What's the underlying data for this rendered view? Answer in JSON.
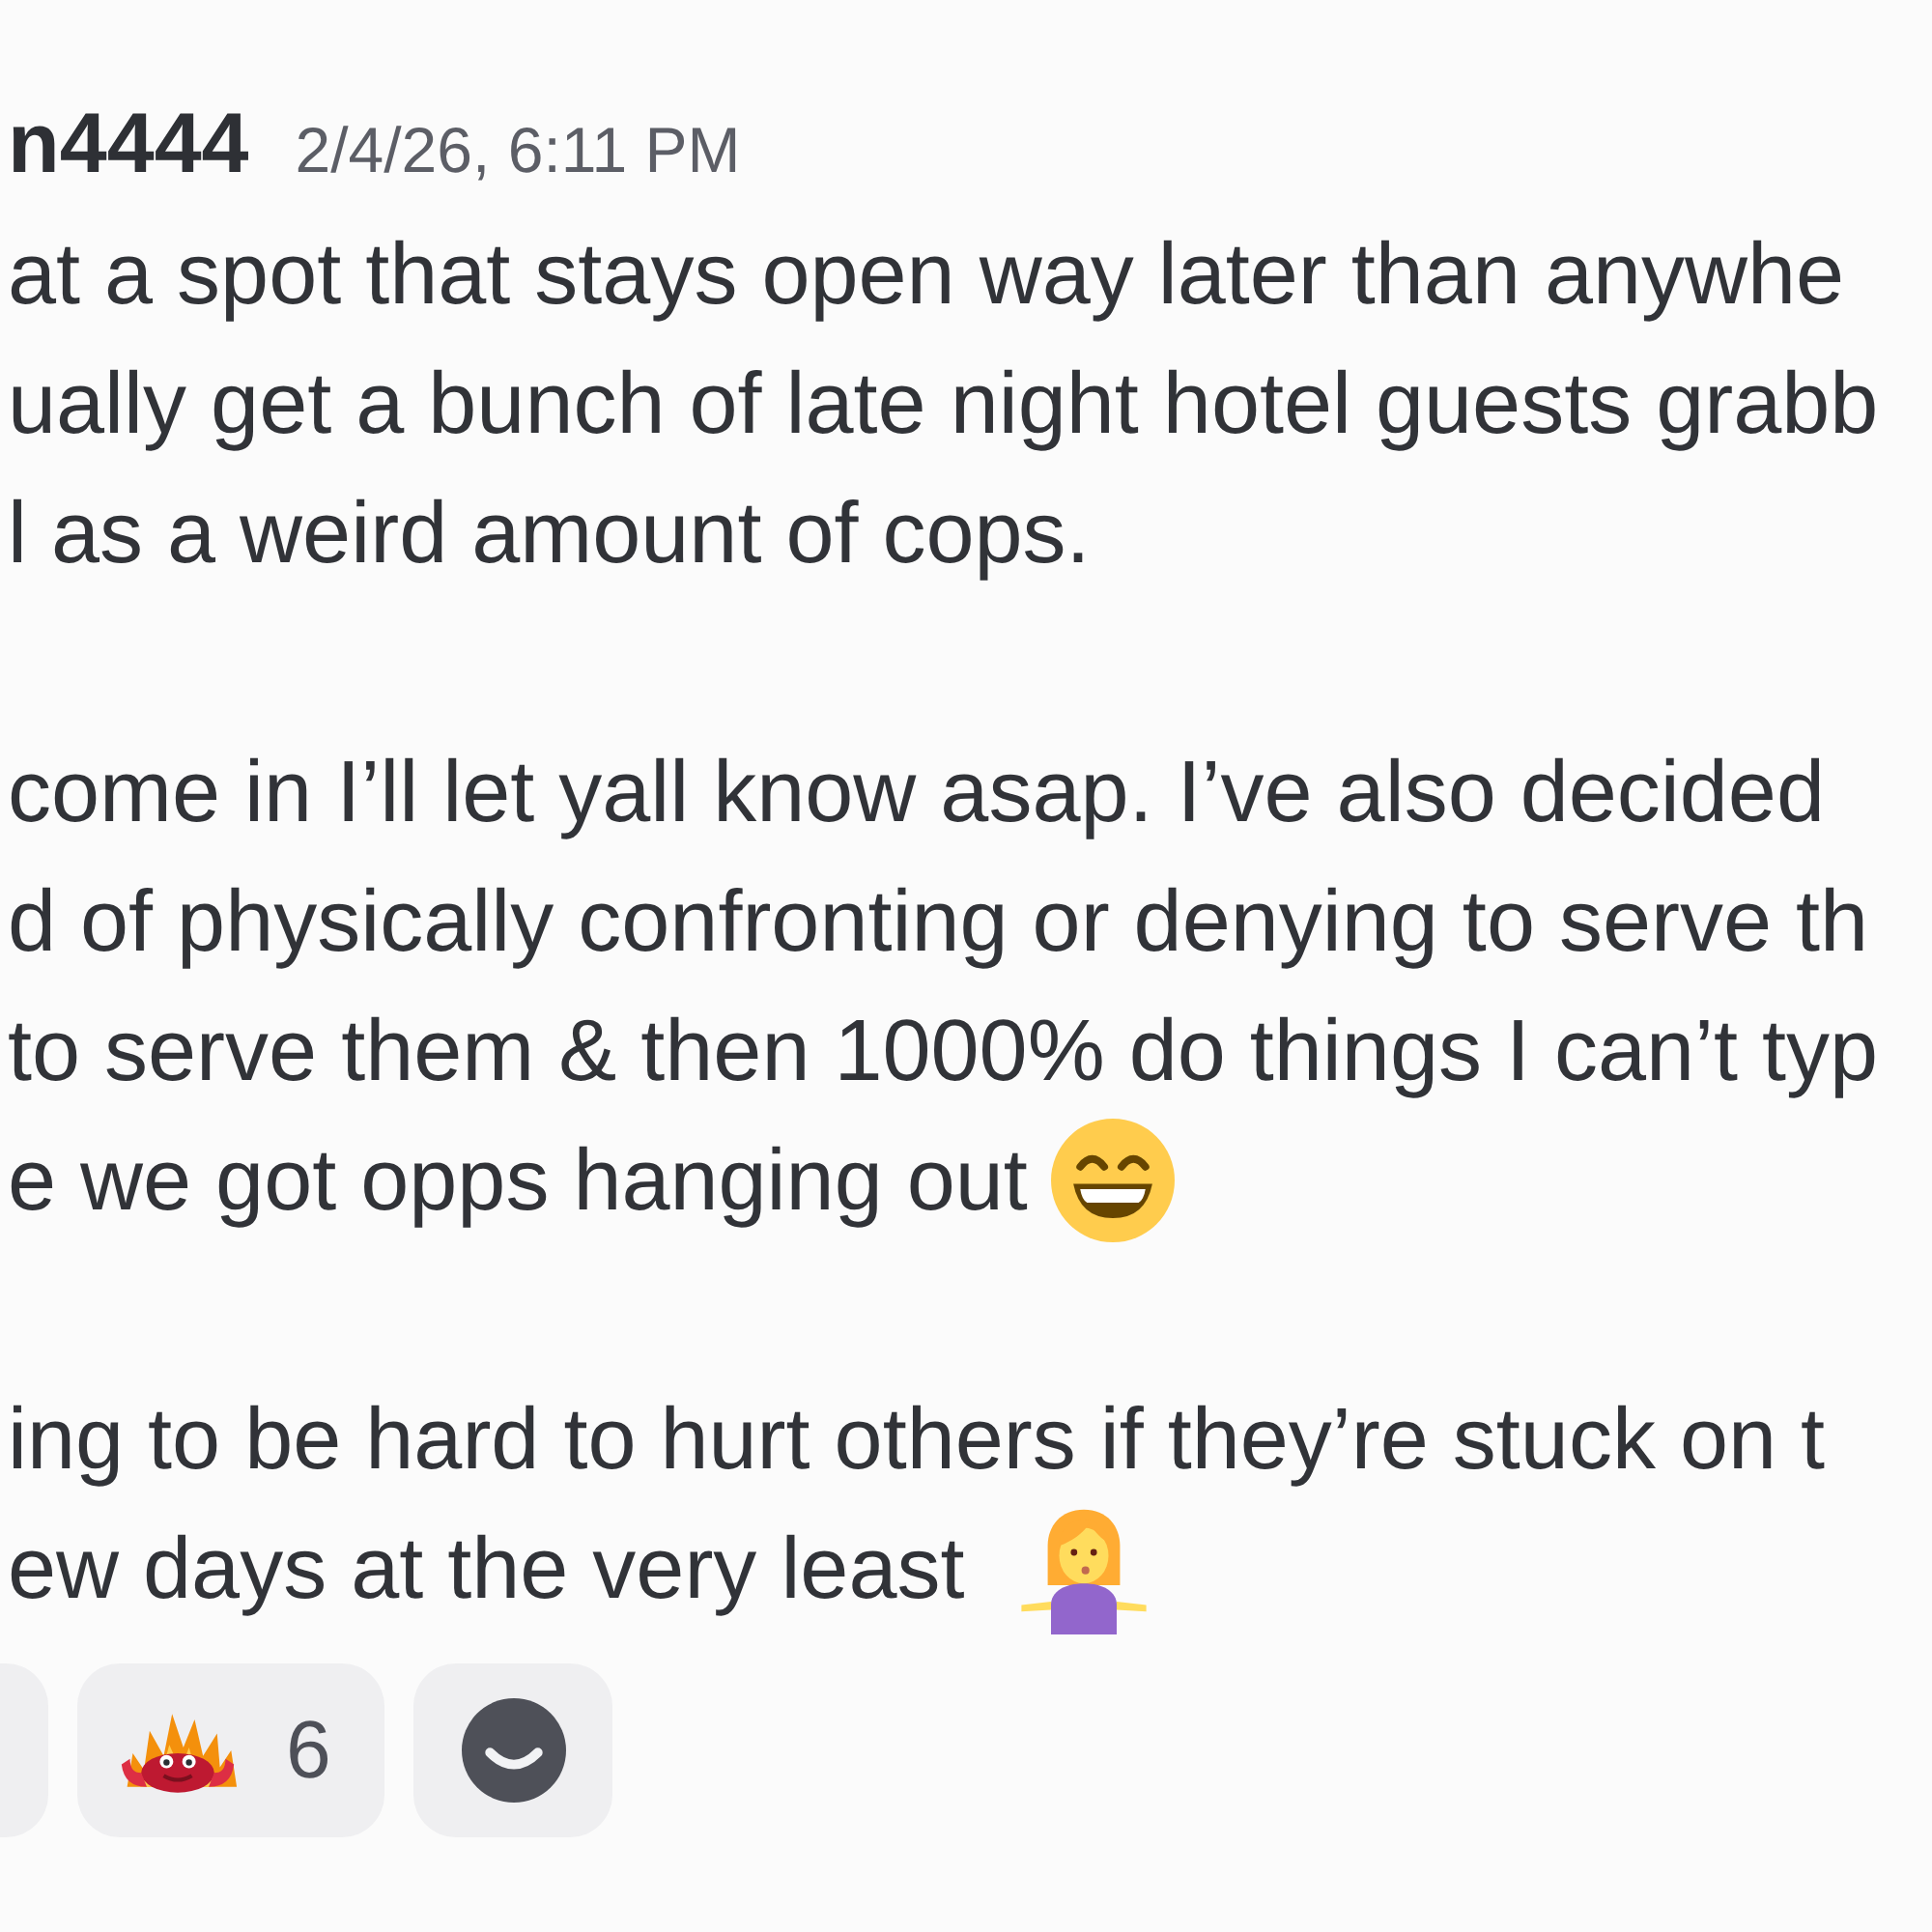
{
  "message": {
    "author": "n4444",
    "timestamp": "2/4/26, 6:11 PM",
    "paragraphs": [
      {
        "lines": [
          {
            "text": "at a spot that stays open way later than anywhe",
            "kind": "plain"
          },
          {
            "text": "ually get a bunch of late night hotel guests grabb",
            "kind": "plain"
          },
          {
            "text": "l as a weird amount of cops.",
            "kind": "plain"
          }
        ]
      },
      {
        "lines": [
          {
            "text": "come in I’ll let yall know asap. I’ve also decided",
            "kind": "plain"
          },
          {
            "text": "d of physically confronting or denying to serve th",
            "kind": "plain"
          },
          {
            "text": "to serve them & then 1000% do things I can’t typ",
            "kind": "plain"
          },
          {
            "text": "e we got opps hanging out",
            "kind": "grinning"
          }
        ]
      },
      {
        "lines": [
          {
            "text": "ing to be hard to hurt others if they’re stuck on t",
            "kind": "plain"
          },
          {
            "text": "ew days at the very least",
            "kind": "shrugging"
          }
        ]
      }
    ],
    "reactions": [
      {
        "kind": "clipped",
        "selected": false
      },
      {
        "kind": "fire_crab",
        "count": "6",
        "selected": false
      }
    ]
  }
}
